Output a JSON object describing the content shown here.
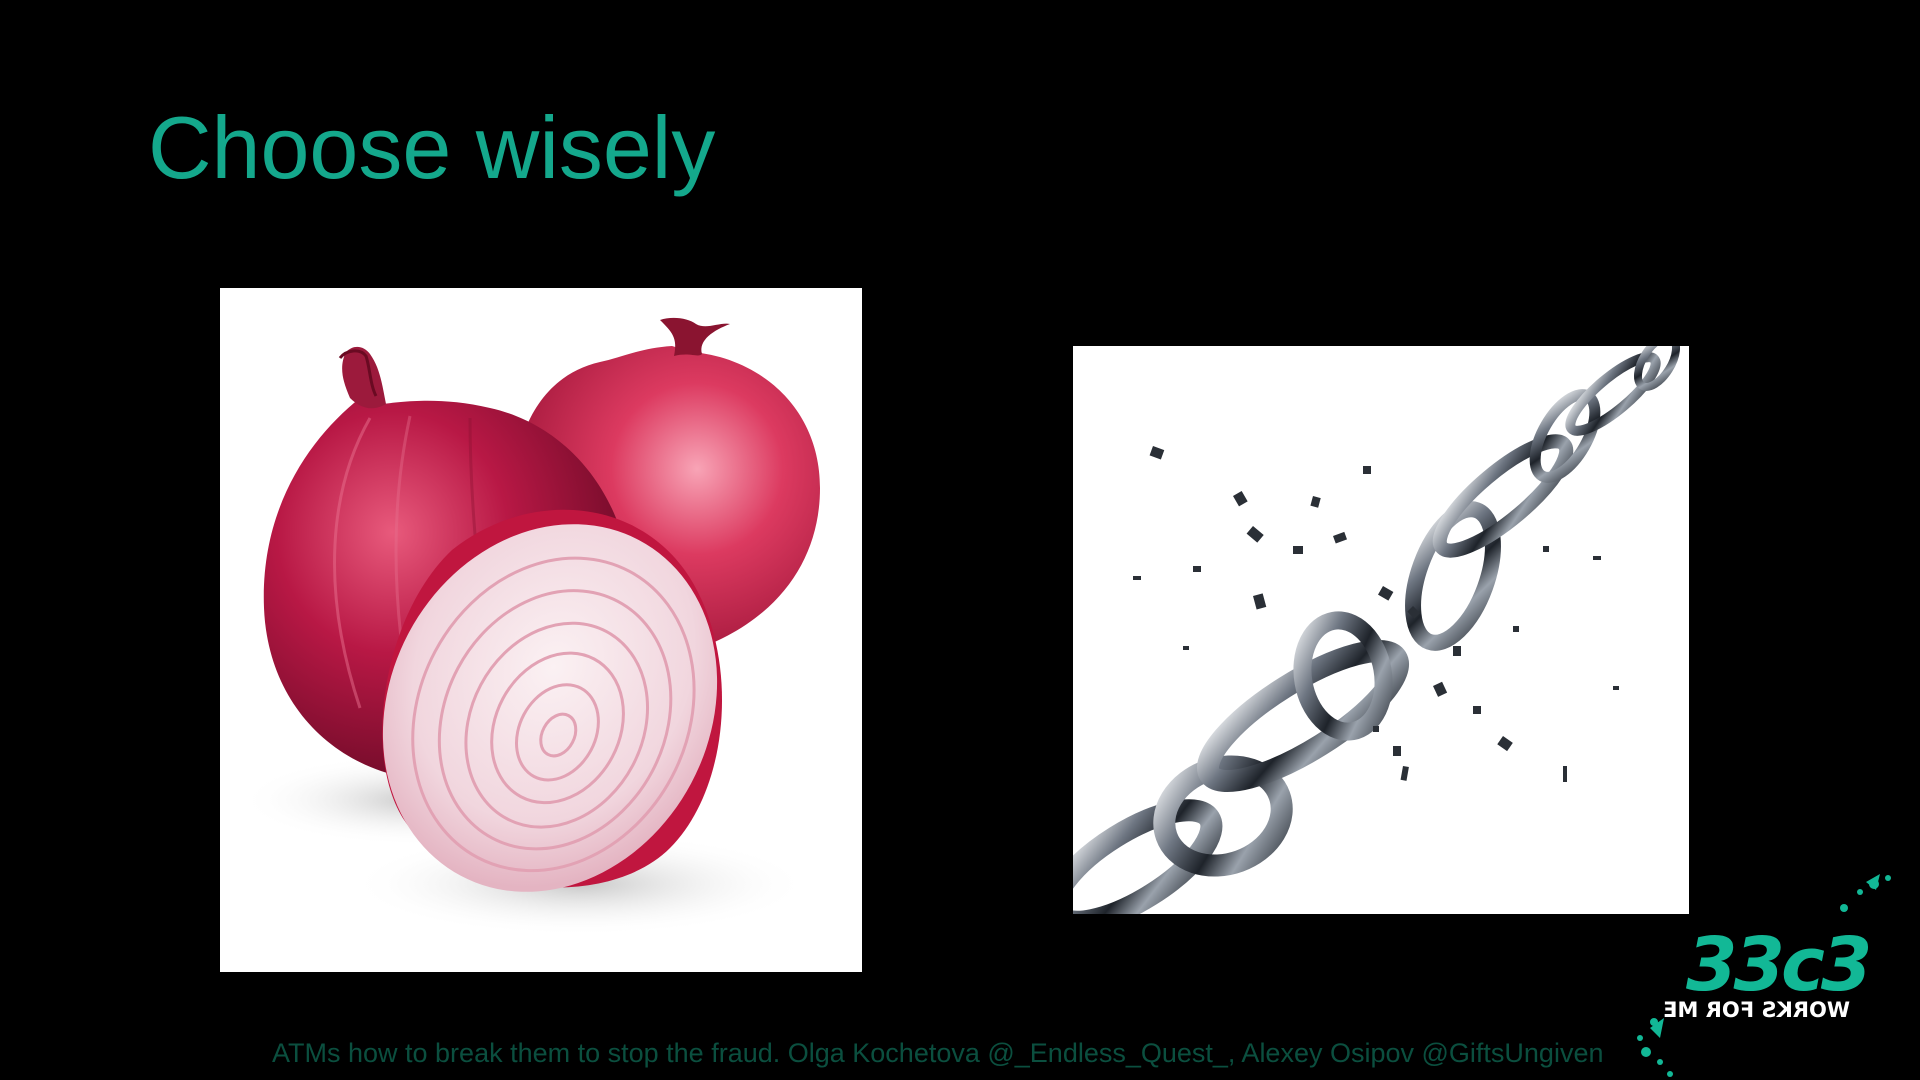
{
  "slide": {
    "title": "Choose wisely",
    "footer": "ATMs how to break them to stop the fraud. Olga Kochetova @_Endless_Quest_, Alexey Osipov @GiftsUngiven"
  },
  "images": [
    {
      "icon": "red-onion-icon"
    },
    {
      "icon": "broken-chain-icon"
    }
  ],
  "logo": {
    "main": "33c3",
    "motto": "WORKS FOR ME"
  },
  "colors": {
    "background": "#000000",
    "title": "#14a88c",
    "footer": "#0b4f3f",
    "logo": "#12b896",
    "onion_skin": "#c01848",
    "onion_flesh": "#f6e4ea"
  }
}
